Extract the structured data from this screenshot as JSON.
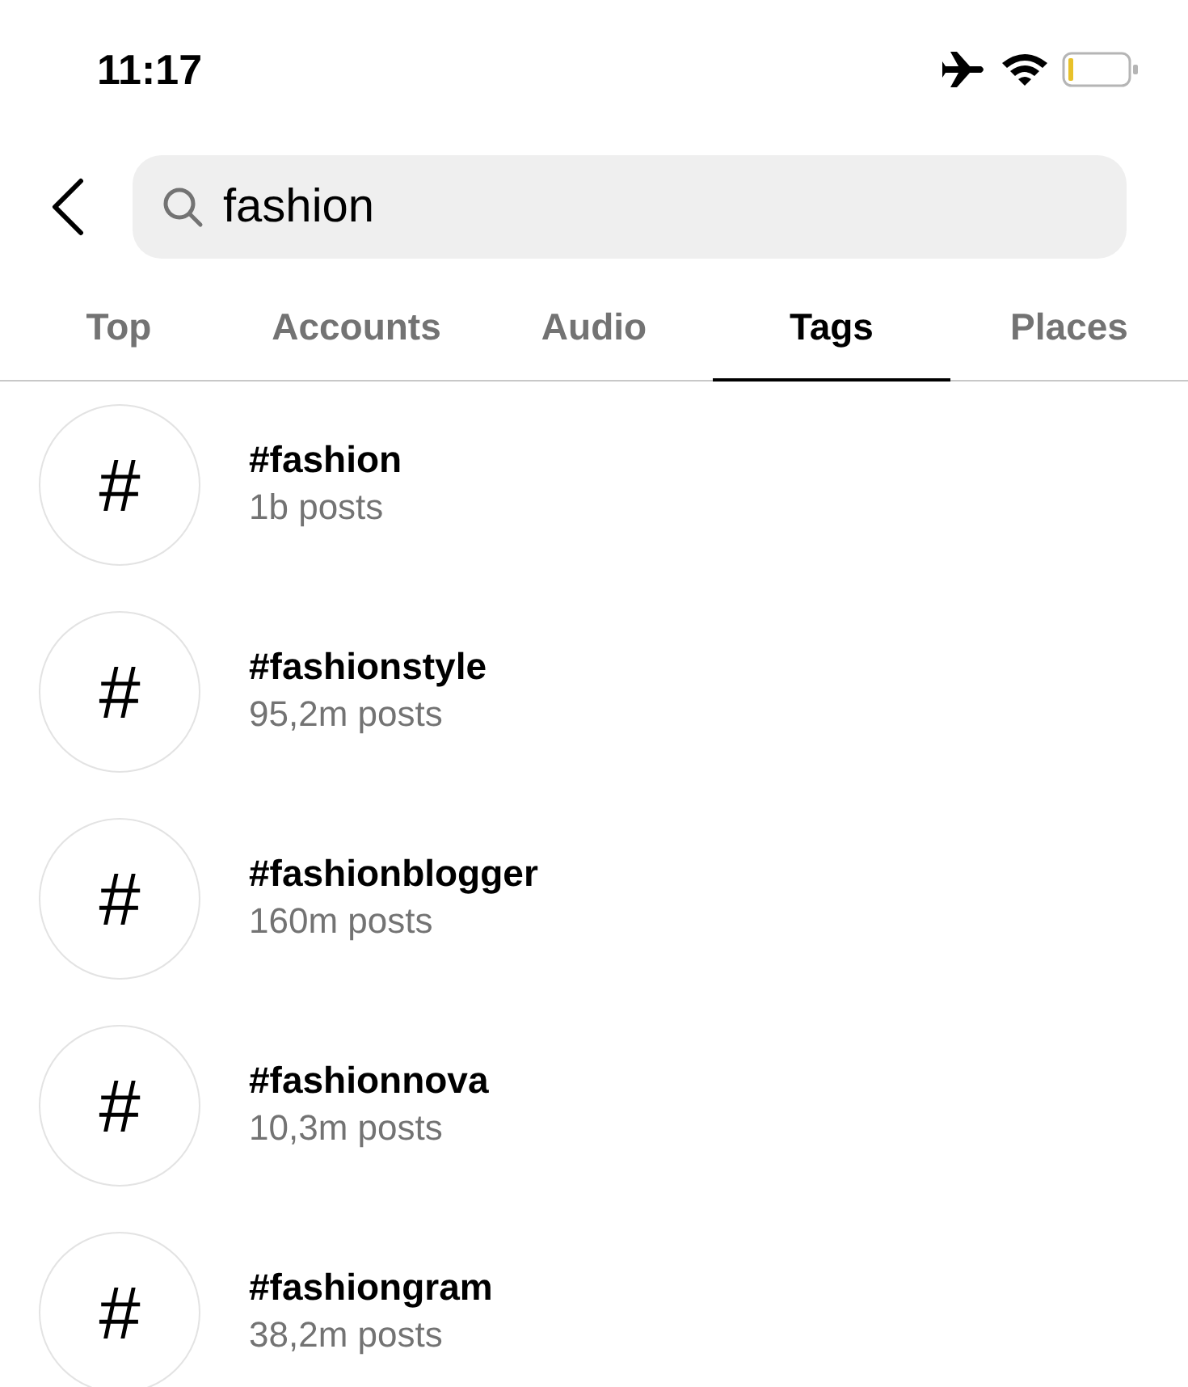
{
  "status_bar": {
    "time": "11:17"
  },
  "search": {
    "value": "fashion"
  },
  "tabs": [
    {
      "label": "Top",
      "selected": false
    },
    {
      "label": "Accounts",
      "selected": false
    },
    {
      "label": "Audio",
      "selected": false
    },
    {
      "label": "Tags",
      "selected": true
    },
    {
      "label": "Places",
      "selected": false
    }
  ],
  "results": [
    {
      "icon": "#",
      "name": "#fashion",
      "count": "1b posts"
    },
    {
      "icon": "#",
      "name": "#fashionstyle",
      "count": "95,2m posts"
    },
    {
      "icon": "#",
      "name": "#fashionblogger",
      "count": "160m posts"
    },
    {
      "icon": "#",
      "name": "#fashionnova",
      "count": "10,3m posts"
    },
    {
      "icon": "#",
      "name": "#fashiongram",
      "count": "38,2m posts"
    }
  ]
}
